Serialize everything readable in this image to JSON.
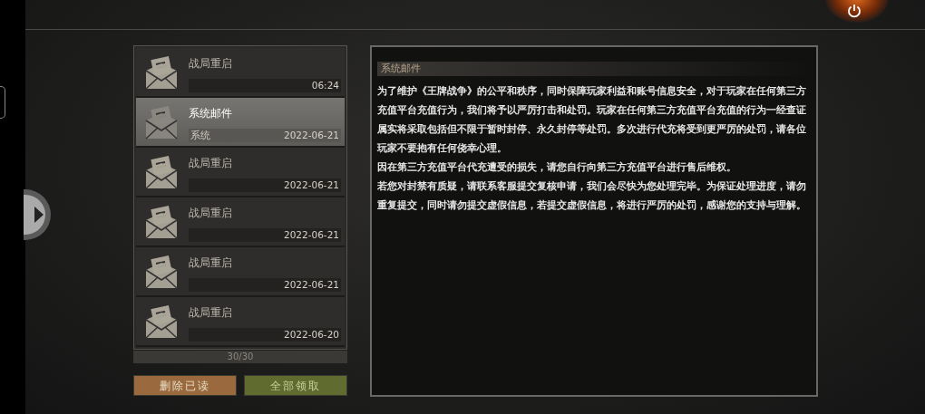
{
  "mails": [
    {
      "title": "战局重启",
      "time": "06:24",
      "selected": false
    },
    {
      "title": "系统邮件",
      "sender": "系统",
      "time": "2022-06-21",
      "selected": true
    },
    {
      "title": "战局重启",
      "time": "2022-06-21",
      "selected": false
    },
    {
      "title": "战局重启",
      "time": "2022-06-21",
      "selected": false
    },
    {
      "title": "战局重启",
      "time": "2022-06-21",
      "selected": false
    },
    {
      "title": "战局重启",
      "time": "2022-06-20",
      "selected": false
    }
  ],
  "mail_count": "30/30",
  "buttons": [
    {
      "label": "删除已读",
      "kind": "delete"
    },
    {
      "label": "全部领取",
      "kind": "claim"
    }
  ],
  "detail": {
    "title": "系统邮件",
    "paragraphs": [
      "为了维护《王牌战争》的公平和秩序，同时保障玩家利益和账号信息安全，对于玩家在任何第三方充值平台充值行为，我们将予以严厉打击和处罚。玩家在任何第三方充值平台充值的行为一经查证属实将采取包括但不限于暂时封停、永久封停等处罚。多次进行代充将受到更严厉的处罚，请各位玩家不要抱有任何侥幸心理。",
      "因在第三方充值平台代充遭受的损失，请您自行向第三方充值平台进行售后维权。",
      "若您对封禁有质疑，请联系客服提交复核申请，我们会尽快为您处理完毕。为保证处理进度，请勿重复提交，同时请勿提交虚假信息，若提交虚假信息，将进行严厉的处罚，感谢您的支持与理解。"
    ]
  }
}
